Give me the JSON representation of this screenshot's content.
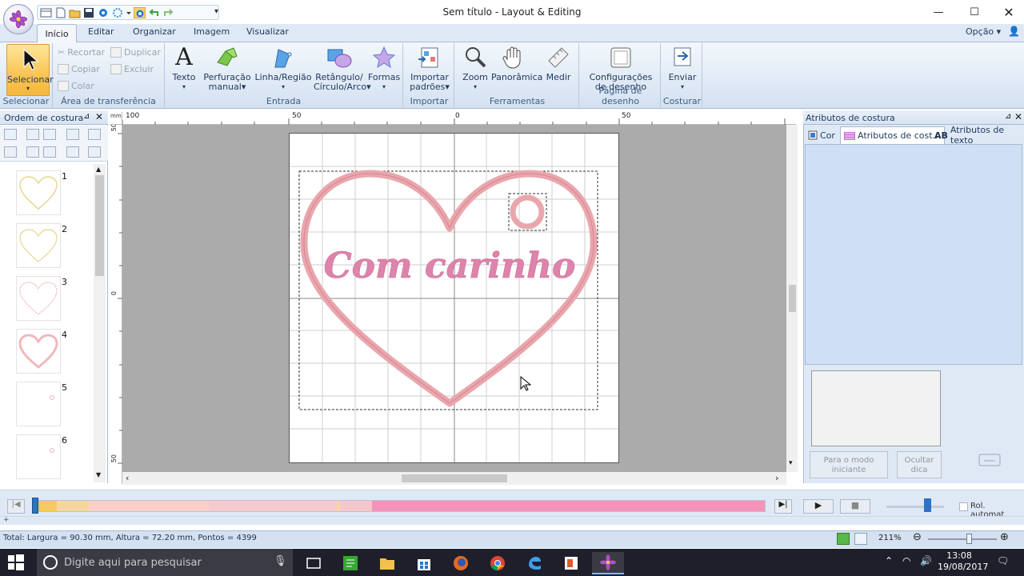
{
  "window": {
    "title": "Sem título - Layout & Editing"
  },
  "ribbon": {
    "tabs": [
      "Início",
      "Editar",
      "Organizar",
      "Imagem",
      "Visualizar"
    ],
    "option": "Opção",
    "groups": {
      "selecionar": {
        "button": "Selecionar",
        "label": "Selecionar"
      },
      "transferencia": {
        "recortar": "Recortar",
        "copiar": "Copiar",
        "colar": "Colar",
        "duplicar": "Duplicar",
        "excluir": "Excluir",
        "label": "Área de transferência"
      },
      "entrada": {
        "texto": "Texto",
        "perfuracao1": "Perfuração",
        "perfuracao2": "manual",
        "linha": "Linha/Região",
        "retangulo1": "Retângulo/",
        "retangulo2": "Círculo/Arco",
        "formas": "Formas",
        "label": "Entrada"
      },
      "importar": {
        "importar1": "Importar",
        "importar2": "padrões",
        "label": "Importar"
      },
      "ferramentas": {
        "zoom": "Zoom",
        "panoramica": "Panorâmica",
        "medir": "Medir",
        "label": "Ferramentas"
      },
      "pagina": {
        "config1": "Configurações",
        "config2": "de desenho",
        "label": "Página de desenho"
      },
      "costurar": {
        "enviar": "Enviar",
        "label": "Costurar"
      }
    }
  },
  "left_panel": {
    "title": "Ordem de costura",
    "items": [
      "1",
      "2",
      "3",
      "4",
      "5",
      "6"
    ]
  },
  "canvas": {
    "design_text": "Com carinho",
    "ruler_top": [
      "100",
      "50",
      "0",
      "50"
    ],
    "ruler_left": [
      "50",
      "0",
      "50"
    ]
  },
  "right_panel": {
    "title": "Atributos de costura",
    "tabs": [
      "Cor",
      "Atributos de cost...",
      "Atributos de texto"
    ],
    "btn_mode_1": "Para o modo",
    "btn_mode_2": "iniciante",
    "btn_hide_1": "Ocultar",
    "btn_hide_2": "dica"
  },
  "sequence": {
    "auto_scroll": "Rol. automat."
  },
  "status": {
    "text": "Total: Largura = 90.30 mm, Altura = 72.20 mm, Pontos = 4399",
    "zoom": "211%"
  },
  "taskbar": {
    "search_placeholder": "Digite aqui para pesquisar",
    "time": "13:08",
    "date": "19/08/2017"
  },
  "colors": {
    "heart": "#eaa6ad",
    "text": "#de84ac",
    "ribbon": "#dfe9f5",
    "selected": "#f8c55a"
  }
}
